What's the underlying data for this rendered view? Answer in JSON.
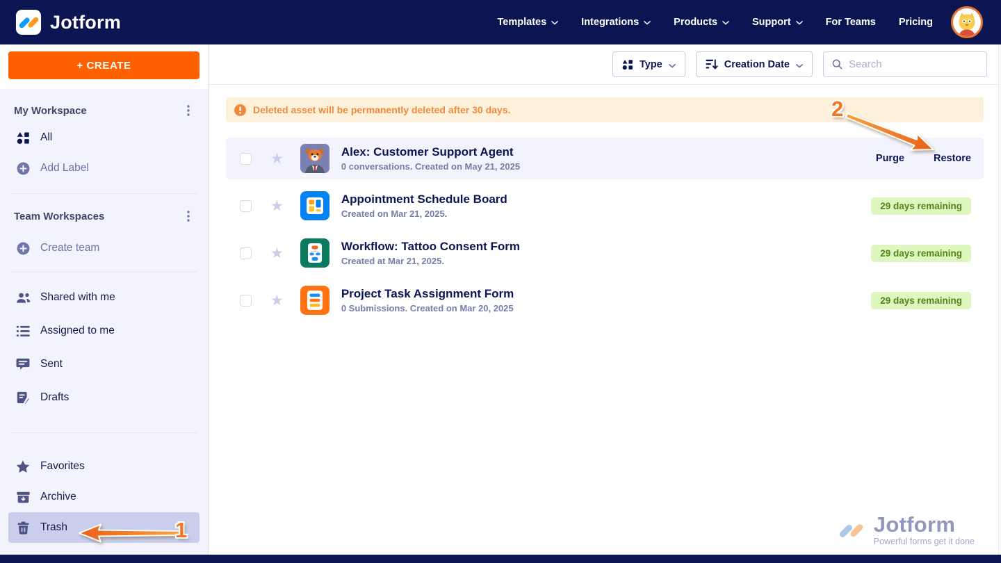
{
  "navbar": {
    "brand": "Jotform",
    "items": [
      {
        "label": "Templates",
        "dropdown": true
      },
      {
        "label": "Integrations",
        "dropdown": true
      },
      {
        "label": "Products",
        "dropdown": true
      },
      {
        "label": "Support",
        "dropdown": true
      },
      {
        "label": "For Teams",
        "dropdown": false
      },
      {
        "label": "Pricing",
        "dropdown": false
      }
    ],
    "avatar_icon": "cat-avatar"
  },
  "sidebar": {
    "create_button": "+ CREATE",
    "my_workspace_title": "My Workspace",
    "team_workspaces_title": "Team Workspaces",
    "items": {
      "all": "All",
      "add_label": "Add Label",
      "create_team": "Create team",
      "shared": "Shared with me",
      "assigned": "Assigned to me",
      "sent": "Sent",
      "drafts": "Drafts",
      "favorites": "Favorites",
      "archive": "Archive",
      "trash": "Trash"
    },
    "selected_item": "Trash"
  },
  "toolbar": {
    "type_label": "Type",
    "sort_label": "Creation Date",
    "search_placeholder": "Search"
  },
  "banner": {
    "text": "Deleted asset will be permanently deleted after 30 days."
  },
  "list": {
    "rows": [
      {
        "title": "Alex: Customer Support Agent",
        "meta": "0 conversations. Created on May 21, 2025",
        "icon": "agent-fox-avatar",
        "actions": {
          "purge": "Purge",
          "restore": "Restore"
        }
      },
      {
        "title": "Appointment Schedule Board",
        "meta": "Created on Mar 21, 2025.",
        "icon": "board-app-icon",
        "badge": "29 days remaining"
      },
      {
        "title": "Workflow: Tattoo Consent Form",
        "meta": "Created at Mar 21, 2025.",
        "icon": "workflow-app-icon",
        "badge": "29 days remaining"
      },
      {
        "title": "Project Task Assignment Form",
        "meta": "0 Submissions. Created on Mar 20, 2025",
        "icon": "form-app-icon",
        "badge": "29 days remaining"
      }
    ]
  },
  "annotations": {
    "step1": "1",
    "step2": "2"
  },
  "watermark": {
    "brand": "Jotform",
    "tagline": "Powerful forms get it done"
  },
  "colors": {
    "brand_navy": "#0a1551",
    "accent_orange": "#ff6100",
    "sidebar_bg": "#f3f3fe",
    "selected_item_bg": "#c9ceec",
    "banner_bg": "#fdf1db",
    "banner_text": "#ee8a3c",
    "badge_bg": "#ddf7be",
    "badge_text": "#54831c",
    "annotation_orange": "#f4731f"
  }
}
